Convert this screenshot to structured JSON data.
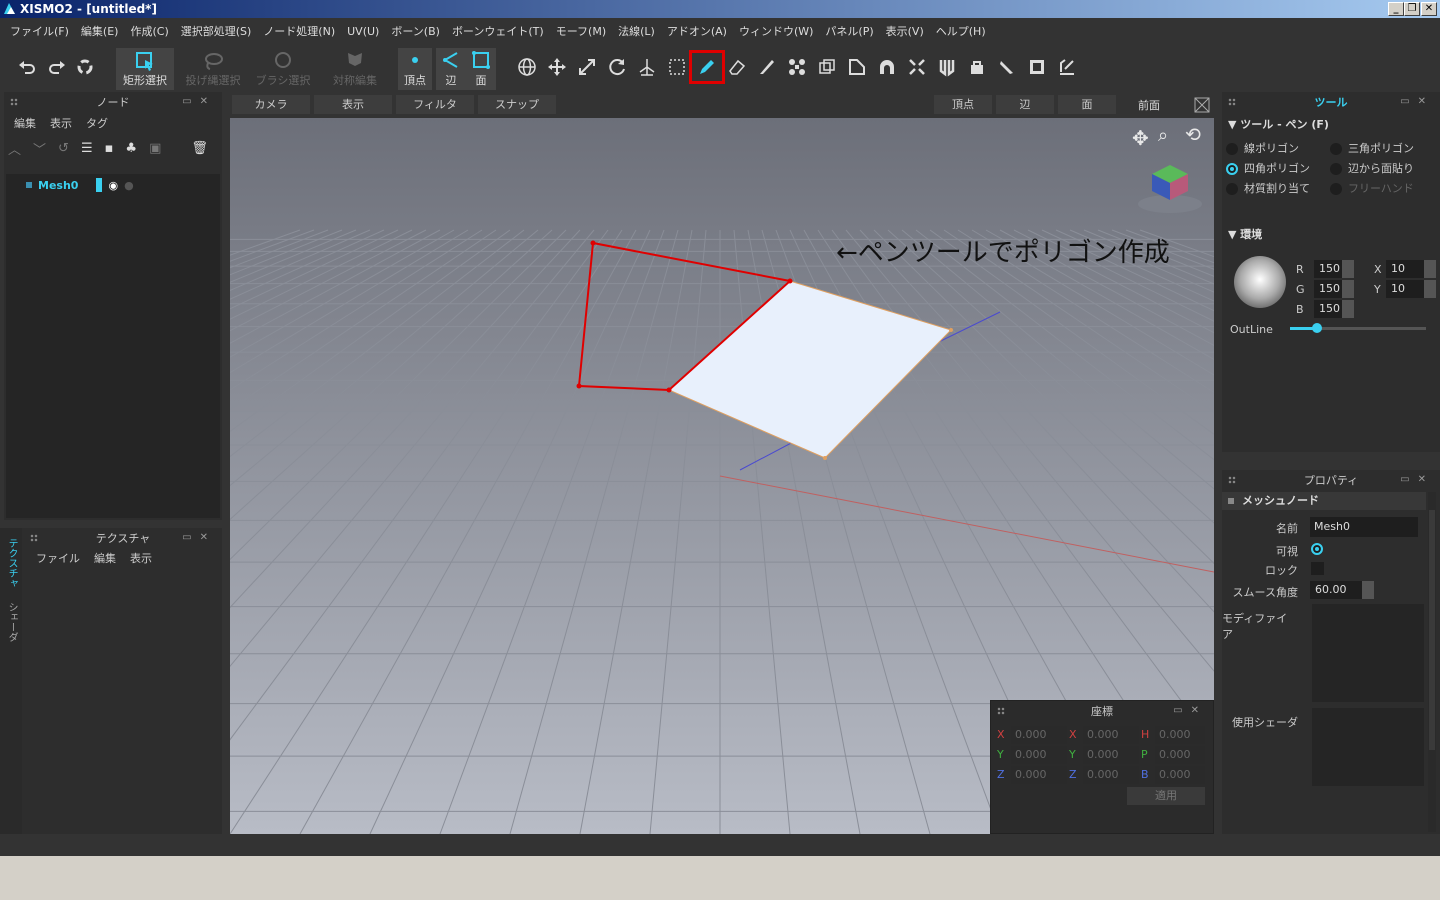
{
  "window": {
    "title": "XISMO2 - [untitled*]",
    "buttons": [
      "_",
      "❐",
      "✕"
    ]
  },
  "menu": [
    "ファイル(F)",
    "編集(E)",
    "作成(C)",
    "選択部処理(S)",
    "ノード処理(N)",
    "UV(U)",
    "ボーン(B)",
    "ボーンウェイト(T)",
    "モーフ(M)",
    "法線(L)",
    "アドオン(A)",
    "ウィンドウ(W)",
    "パネル(P)",
    "表示(V)",
    "ヘルプ(H)"
  ],
  "toolbar": {
    "rect_select": "矩形選択",
    "lasso_select": "投げ縄選択",
    "brush_select": "ブラシ選択",
    "symmetric_edit": "対称編集",
    "vertex": "頂点",
    "edge": "辺",
    "face": "面"
  },
  "node_panel": {
    "title": "ノード",
    "menu": [
      "編集",
      "表示",
      "タグ"
    ],
    "items": [
      {
        "name": "Mesh0"
      }
    ]
  },
  "texture_panel": {
    "title": "テクスチャ",
    "menu": [
      "ファイル",
      "編集",
      "表示"
    ],
    "side_tabs": [
      "テクスチャ",
      "シェーダ"
    ]
  },
  "viewport": {
    "buttons": [
      "カメラ",
      "表示",
      "フィルタ",
      "スナップ"
    ],
    "mode_buttons": [
      "頂点",
      "辺",
      "面"
    ],
    "view_label": "前面",
    "annotation": "←ペンツールでポリゴン作成"
  },
  "tool_panel": {
    "title": "ツール",
    "section": "ツール - ペン (F)",
    "options": [
      {
        "label": "線ポリゴン",
        "on": false
      },
      {
        "label": "三角ポリゴン",
        "on": false
      },
      {
        "label": "四角ポリゴン",
        "on": true
      },
      {
        "label": "辺から面貼り",
        "on": false
      },
      {
        "label": "材質割り当て",
        "on": false
      },
      {
        "label": "フリーハンド",
        "on": false
      }
    ],
    "env_section": "環境",
    "r_label": "R",
    "r": "150",
    "g_label": "G",
    "g": "150",
    "b_label": "B",
    "b": "150",
    "x_label": "X",
    "x": "10",
    "y_label": "Y",
    "y": "10",
    "outline_label": "OutLine",
    "outline_level": 0.2
  },
  "property_panel": {
    "title": "プロパティ",
    "section": "メッシュノード",
    "name_label": "名前",
    "name_value": "Mesh0",
    "visible_label": "可視",
    "lock_label": "ロック",
    "smooth_label": "スムース角度",
    "smooth_value": "60.00",
    "modifier_label": "モディファイア",
    "shader_label": "使用シェーダ"
  },
  "coord_panel": {
    "title": "座標",
    "rows": [
      {
        "a": "X",
        "b": "X",
        "c": "H",
        "v1": "0.000",
        "v2": "0.000",
        "v3": "0.000"
      },
      {
        "a": "Y",
        "b": "Y",
        "c": "P",
        "v1": "0.000",
        "v2": "0.000",
        "v3": "0.000"
      },
      {
        "a": "Z",
        "b": "Z",
        "c": "B",
        "v1": "0.000",
        "v2": "0.000",
        "v3": "0.000"
      }
    ],
    "apply": "適用"
  },
  "colors": {
    "accent": "#3ad0f0",
    "highlight": "#e00000",
    "viewport_top": "#6e717b",
    "viewport_bottom": "#b8bcc6"
  }
}
